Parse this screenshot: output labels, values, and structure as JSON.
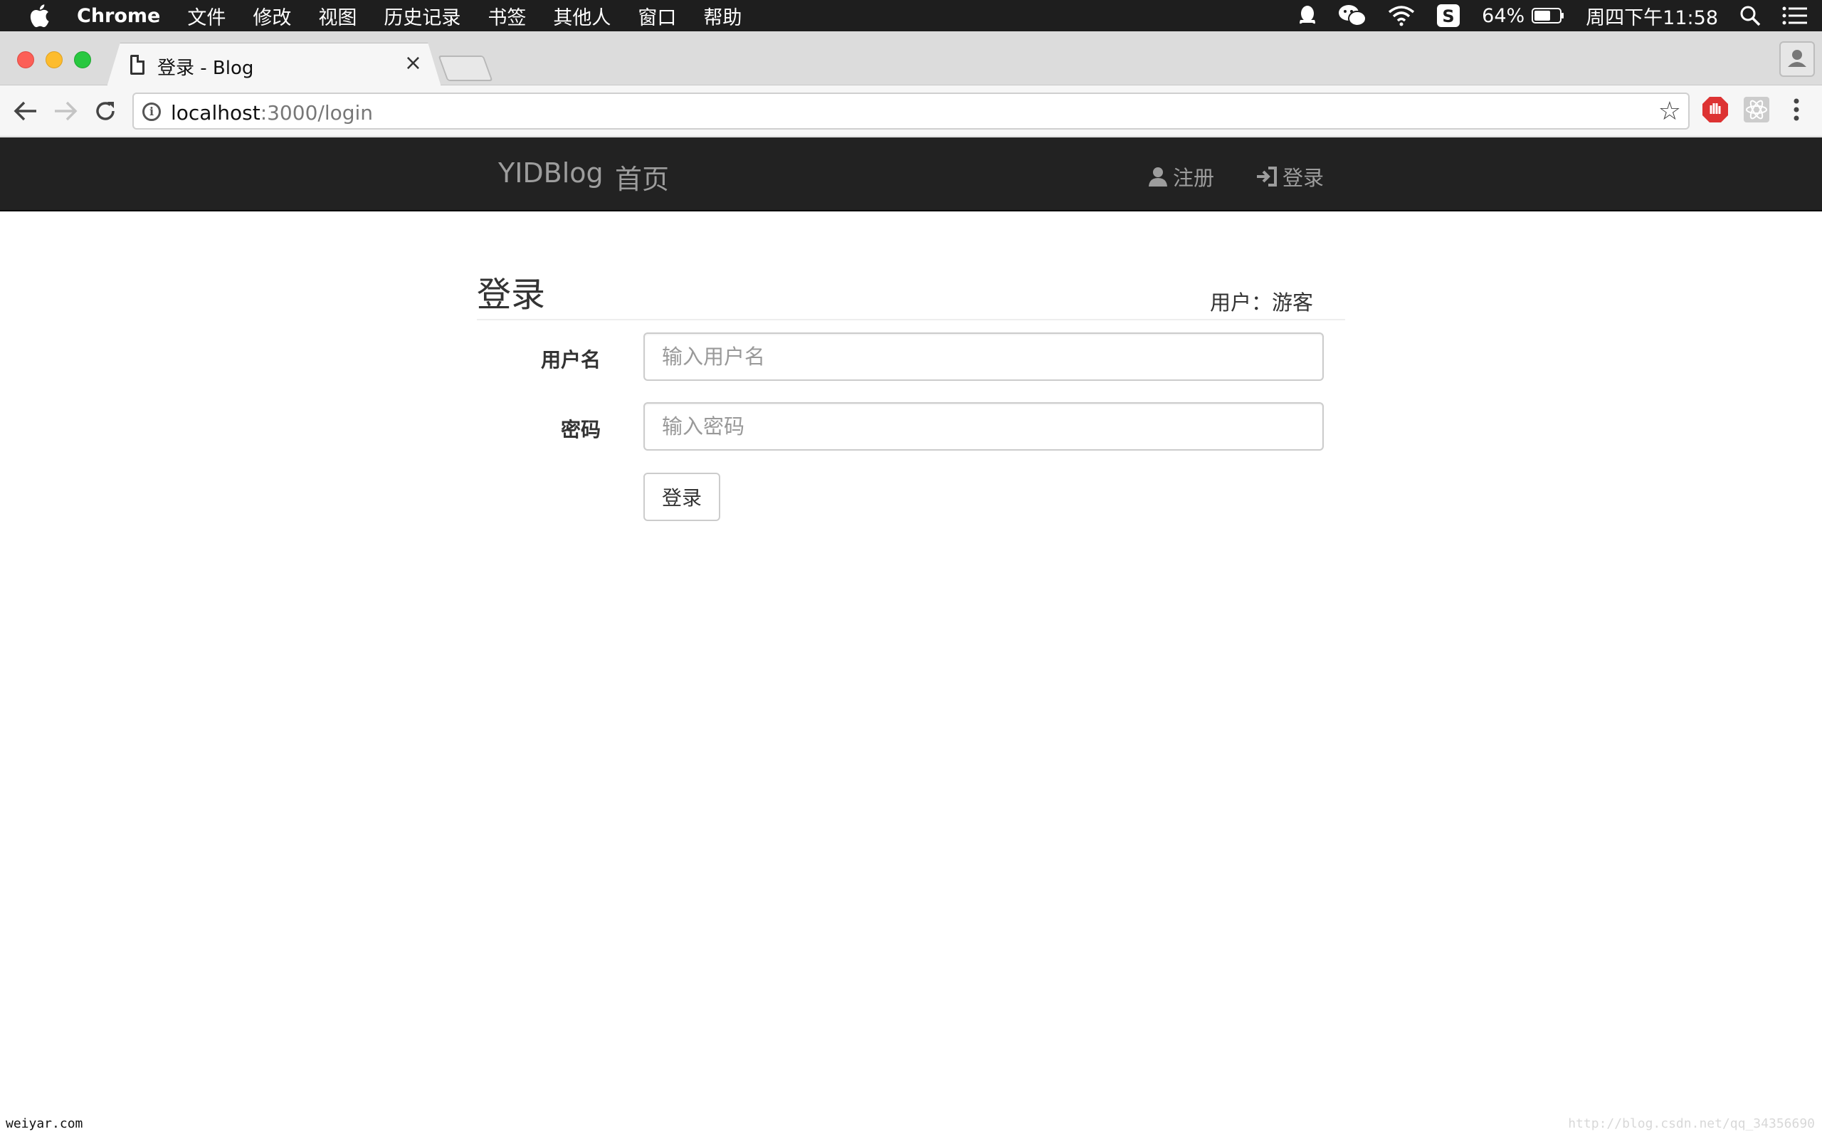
{
  "menubar": {
    "app_name": "Chrome",
    "items": [
      "文件",
      "修改",
      "视图",
      "历史记录",
      "书签",
      "其他人",
      "窗口",
      "帮助"
    ],
    "battery": "64%",
    "clock": "周四下午11:58"
  },
  "browser": {
    "tab_title": "登录 - Blog",
    "tab_close": "×",
    "url_host": "localhost",
    "url_path": ":3000/login"
  },
  "site_nav": {
    "brand": "YIDBlog",
    "home": "首页",
    "register": "注册",
    "login": "登录"
  },
  "page": {
    "heading": "登录",
    "user_status": "用户：游客",
    "username_label": "用户名",
    "username_placeholder": "输入用户名",
    "password_label": "密码",
    "password_placeholder": "输入密码",
    "submit_label": "登录"
  },
  "watermarks": {
    "left": "weiyar.com",
    "right": "http://blog.csdn.net/qq_34356690"
  },
  "colors": {
    "navbar_bg": "#222222",
    "navbar_text": "#9d9d9d",
    "menubar_bg": "#1e1e1e"
  }
}
